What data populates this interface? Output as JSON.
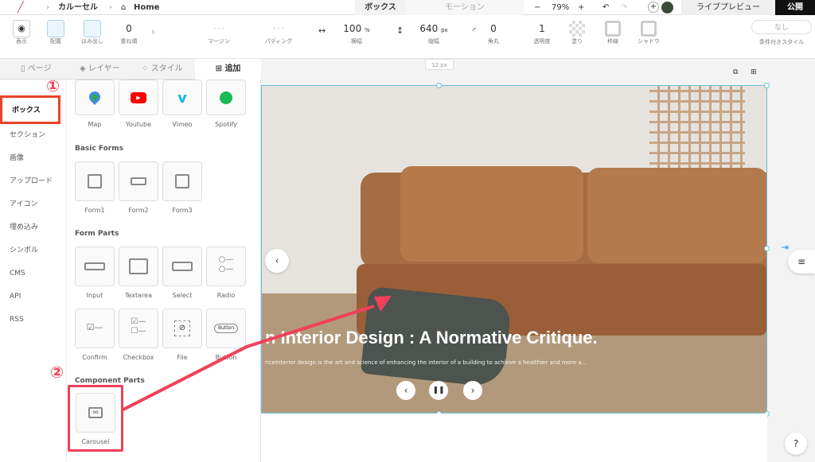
{
  "topbar": {
    "breadcrumb_1": "カルーセル",
    "breadcrumb_2": "Home",
    "tab_box": "ボックス",
    "tab_motion": "モーション",
    "zoom": "79%",
    "live_preview": "ライブプレビュー",
    "publish": "公開",
    "minus": "−",
    "plus": "+"
  },
  "toolbar": {
    "display": "表示",
    "align": "配置",
    "overflow": "はみ出し",
    "stack_value": "0",
    "stack": "重ね順",
    "margin": "マージン",
    "padding": "パディング",
    "width_value": "100",
    "width_unit": "%",
    "width": "横幅",
    "height_value": "640",
    "height_unit": "px",
    "height": "縦幅",
    "radius_value": "0",
    "radius": "角丸",
    "opacity_value": "1",
    "opacity": "透明度",
    "fill": "塗り",
    "border": "枠線",
    "shadow": "シャドウ",
    "condition_value": "なし",
    "condition": "条件付きスタイル"
  },
  "panel_tabs": {
    "page": "ページ",
    "layer": "レイヤー",
    "style": "スタイル",
    "add": "追加"
  },
  "nav": [
    "ボックス",
    "セクション",
    "画像",
    "アップロード",
    "アイコン",
    "埋め込み",
    "シンボル",
    "CMS",
    "API",
    "RSS"
  ],
  "embeds": [
    "Map",
    "Youtube",
    "Vimeo",
    "Spotify"
  ],
  "basic_forms_title": "Basic Forms",
  "basic_forms": [
    "Form1",
    "Form2",
    "Form3"
  ],
  "form_parts_title": "Form Parts",
  "form_parts": [
    "Input",
    "Textarea",
    "Select",
    "Radio",
    "Confirm",
    "Checkbox",
    "File",
    "Button"
  ],
  "button_chip": "Button",
  "component_parts_title": "Component Parts",
  "component_parts": [
    "Carousel"
  ],
  "markers": [
    "①",
    "②"
  ],
  "canvas": {
    "size_tag": "12 px",
    "slide_title": "n Interior Design : A Normative Critique.",
    "slide_text": "riceInterior design is the art and science of enhancing the interior of a building to achieve a healthier and more a..."
  },
  "help": "?",
  "colors": {
    "annotation": "#f0405a",
    "highlight": "#e8442a",
    "selection": "#6cc0d8"
  }
}
